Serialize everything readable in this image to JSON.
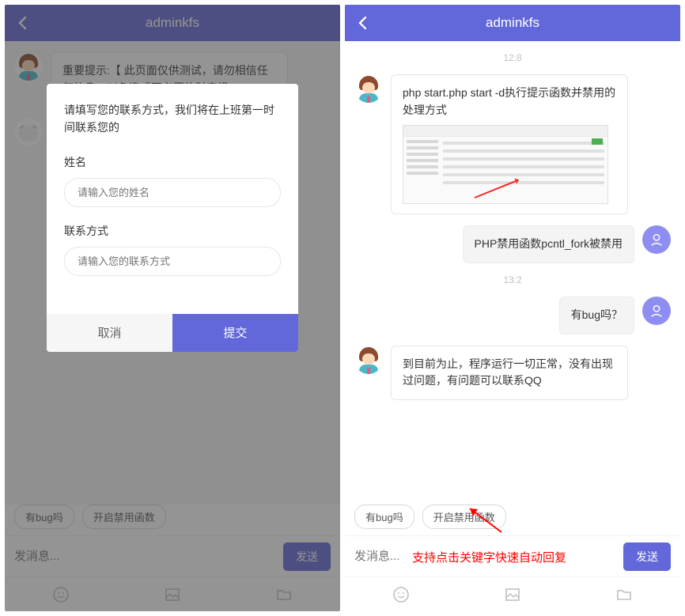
{
  "header": {
    "title": "adminkfs"
  },
  "left": {
    "notice": "重要提示:【 此页面仅供测试，请勿相信任何信息，以免造成不必要的财产损",
    "modal": {
      "prompt": "请填写您的联系方式，我们将在上班第一时间联系您的",
      "name_label": "姓名",
      "name_placeholder": "请输入您的姓名",
      "contact_label": "联系方式",
      "contact_placeholder": "请输入您的联系方式",
      "cancel": "取消",
      "confirm": "提交"
    }
  },
  "right": {
    "ts1": "12:8",
    "msg1_text": "php start.php start -d执行提示函数并禁用的处理方式",
    "msg2_text": "PHP禁用函数pcntl_fork被禁用",
    "ts2": "13:2",
    "msg3_text": "有bug吗？",
    "msg4_text": "到目前为止，程序运行一切正常，没有出现过问题，有问题可以联系QQ"
  },
  "chips": {
    "c1": "有bug吗",
    "c2": "开启禁用函数"
  },
  "composer": {
    "placeholder": "发消息...",
    "send": "发送"
  },
  "annotation": "支持点击关键字快速自动回复"
}
